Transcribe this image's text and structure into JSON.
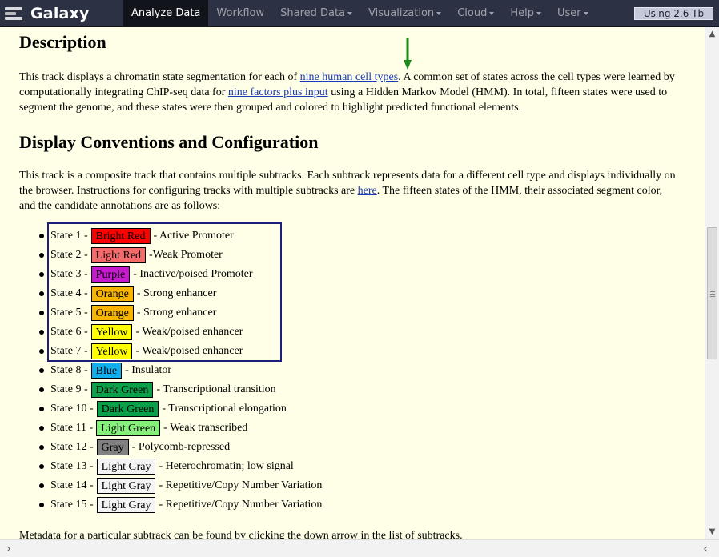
{
  "masthead": {
    "brand": "Galaxy",
    "tabs": [
      {
        "label": "Analyze Data"
      },
      {
        "label": "Workflow"
      },
      {
        "label": "Shared Data"
      },
      {
        "label": "Visualization"
      },
      {
        "label": "Cloud"
      },
      {
        "label": "Help"
      },
      {
        "label": "User"
      }
    ],
    "quota": "Using 2.6 Tb"
  },
  "description": {
    "heading": "Description",
    "p1": "This track displays a chromatin state segmentation for each of ",
    "link1": "nine human cell types",
    "p2": ". A common set of states across the cell types were learned by computationally integrating ChIP-seq data for ",
    "link2": "nine factors plus input",
    "p3": " using a Hidden Markov Model (HMM). In total, fifteen states were used to segment the genome, and these states were then grouped and colored to highlight predicted functional elements."
  },
  "display": {
    "heading": "Display Conventions and Configuration",
    "p1": "This track is a composite track that contains multiple subtracks. Each subtrack represents data for a different cell type and displays individually on the browser. Instructions for configuring tracks with multiple subtracks are ",
    "link": "here",
    "p2": ". The fifteen states of the HMM, their associated segment color, and the candidate annotations are as follows:"
  },
  "states": [
    {
      "label": "State 1 -",
      "color": "Bright Red",
      "bg": "#ff0000",
      "desc": "- Active Promoter"
    },
    {
      "label": "State 2 -",
      "color": "Light Red",
      "bg": "#f46a6a",
      "desc": "-Weak Promoter"
    },
    {
      "label": "State 3 -",
      "color": "Purple",
      "bg": "#c71ad0",
      "desc": "- Inactive/poised Promoter"
    },
    {
      "label": "State 4 -",
      "color": "Orange",
      "bg": "#f7b400",
      "desc": "- Strong enhancer"
    },
    {
      "label": "State 5 -",
      "color": "Orange",
      "bg": "#f7b400",
      "desc": "- Strong enhancer"
    },
    {
      "label": "State 6 -",
      "color": "Yellow",
      "bg": "#ffff00",
      "desc": "- Weak/poised enhancer"
    },
    {
      "label": "State 7 -",
      "color": "Yellow",
      "bg": "#ffff00",
      "desc": "- Weak/poised enhancer"
    },
    {
      "label": "State 8 -",
      "color": "Blue",
      "bg": "#10b0ef",
      "desc": "- Insulator"
    },
    {
      "label": "State 9 -",
      "color": "Dark Green",
      "bg": "#0aa04a",
      "desc": "- Transcriptional transition"
    },
    {
      "label": "State 10 -",
      "color": "Dark Green",
      "bg": "#0aa04a",
      "desc": "- Transcriptional elongation"
    },
    {
      "label": "State 11 -",
      "color": "Light Green",
      "bg": "#85f07a",
      "desc": "- Weak transcribed"
    },
    {
      "label": "State 12 -",
      "color": "Gray",
      "bg": "#808080",
      "desc": "- Polycomb-repressed"
    },
    {
      "label": "State 13 -",
      "color": "Light Gray",
      "bg": "#f4f4f4",
      "desc": "- Heterochromatin; low signal"
    },
    {
      "label": "State 14 -",
      "color": "Light Gray",
      "bg": "#f4f4f4",
      "desc": "- Repetitive/Copy Number Variation"
    },
    {
      "label": "State 15 -",
      "color": "Light Gray",
      "bg": "#f4f4f4",
      "desc": "- Repetitive/Copy Number Variation"
    }
  ],
  "metadata_note": "Metadata for a particular subtrack can be found by clicking the down arrow in the list of subtracks.",
  "colors": {
    "masthead_bg": "#2c3143",
    "active_tab_bg": "#12141b",
    "page_bg": "#fffee6",
    "link": "#1b3bb6",
    "highlight_border": "#1c1f7a",
    "arrow": "#1a8a1a"
  },
  "icons": {
    "logo": "galaxy-logo-icon",
    "arrow": "down-arrow-icon",
    "scroll_up": "chevron-up-icon",
    "scroll_down": "chevron-down-icon",
    "scroll_left": "chevron-left-icon",
    "scroll_right": "chevron-right-icon"
  }
}
